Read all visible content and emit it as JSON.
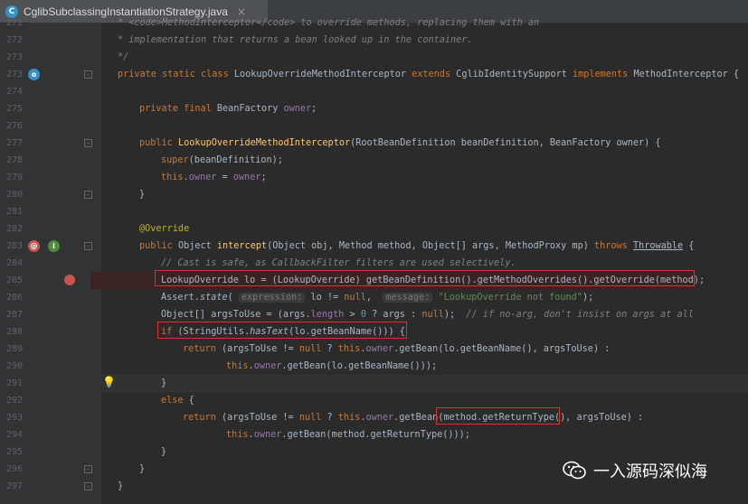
{
  "tab": {
    "title": "CglibSubclassingInstantiationStrategy.java",
    "close": "×",
    "icon": "C"
  },
  "watermark": "一入源码深似海",
  "lines": [
    {
      "n": "271",
      "t": "* <code>MethodInterceptor</code> to override methods, replacing them with an"
    },
    {
      "n": "272",
      "t": "* implementation that returns a bean looked up in the container."
    },
    {
      "n": "273",
      "t": "*/"
    },
    {
      "n": "273",
      "t": "private static class LookupOverrideMethodInterceptor extends CglibIdentitySupport implements MethodInterceptor {"
    },
    {
      "n": "274",
      "t": ""
    },
    {
      "n": "275",
      "t": "private final BeanFactory owner;"
    },
    {
      "n": "276",
      "t": ""
    },
    {
      "n": "277",
      "t": "public LookupOverrideMethodInterceptor(RootBeanDefinition beanDefinition, BeanFactory owner) {"
    },
    {
      "n": "278",
      "t": "super(beanDefinition);"
    },
    {
      "n": "279",
      "t": "this.owner = owner;"
    },
    {
      "n": "280",
      "t": "}"
    },
    {
      "n": "281",
      "t": ""
    },
    {
      "n": "282",
      "t": "@Override"
    },
    {
      "n": "283",
      "t": "public Object intercept(Object obj, Method method, Object[] args, MethodProxy mp) throws Throwable {"
    },
    {
      "n": "284",
      "t": "// Cast is safe, as CallbackFilter filters are used selectively."
    },
    {
      "n": "285",
      "t": "LookupOverride lo = (LookupOverride) getBeanDefinition().getMethodOverrides().getOverride(method);"
    },
    {
      "n": "286",
      "t": "Assert.state( expression: lo != null,  message: \"LookupOverride not found\");"
    },
    {
      "n": "287",
      "t": "Object[] argsToUse = (args.length > 0 ? args : null);  // if no-arg, don't insist on args at all"
    },
    {
      "n": "288",
      "t": "if (StringUtils.hasText(lo.getBeanName())) {"
    },
    {
      "n": "289",
      "t": "return (argsToUse != null ? this.owner.getBean(lo.getBeanName(), argsToUse) :"
    },
    {
      "n": "290",
      "t": "this.owner.getBean(lo.getBeanName()));"
    },
    {
      "n": "291",
      "t": "}"
    },
    {
      "n": "292",
      "t": "else {"
    },
    {
      "n": "293",
      "t": "return (argsToUse != null ? this.owner.getBean(method.getReturnType(), argsToUse) :"
    },
    {
      "n": "294",
      "t": "this.owner.getBean(method.getReturnType()));"
    },
    {
      "n": "295",
      "t": "}"
    },
    {
      "n": "296",
      "t": "}"
    },
    {
      "n": "297",
      "t": "}"
    }
  ],
  "hints": {
    "expression": "expression:",
    "message": "message:"
  },
  "colors": {
    "breakpoint": "#c75450",
    "highlight_box": "#e0302f",
    "keyword": "#cc7832",
    "method": "#ffc66d",
    "field": "#9876aa",
    "string": "#6a8759"
  }
}
